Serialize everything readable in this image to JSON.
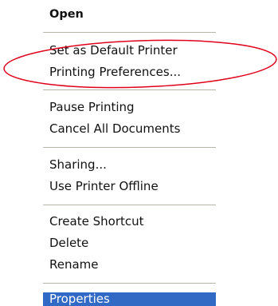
{
  "menu": {
    "items": [
      {
        "label": "Open",
        "default": true
      },
      {
        "label": "Set as Default Printer"
      },
      {
        "label": "Printing Preferences..."
      },
      {
        "label": "Pause Printing"
      },
      {
        "label": "Cancel All Documents"
      },
      {
        "label": "Sharing..."
      },
      {
        "label": "Use Printer Offline"
      },
      {
        "label": "Create Shortcut"
      },
      {
        "label": "Delete"
      },
      {
        "label": "Rename"
      },
      {
        "label": "Properties",
        "selected": true
      }
    ],
    "highlight_color": "#316ac5",
    "separator_color": "#b8b5aa"
  },
  "annotation": {
    "shape": "ellipse",
    "color": "#e0001b",
    "target": "Printing Preferences..."
  }
}
